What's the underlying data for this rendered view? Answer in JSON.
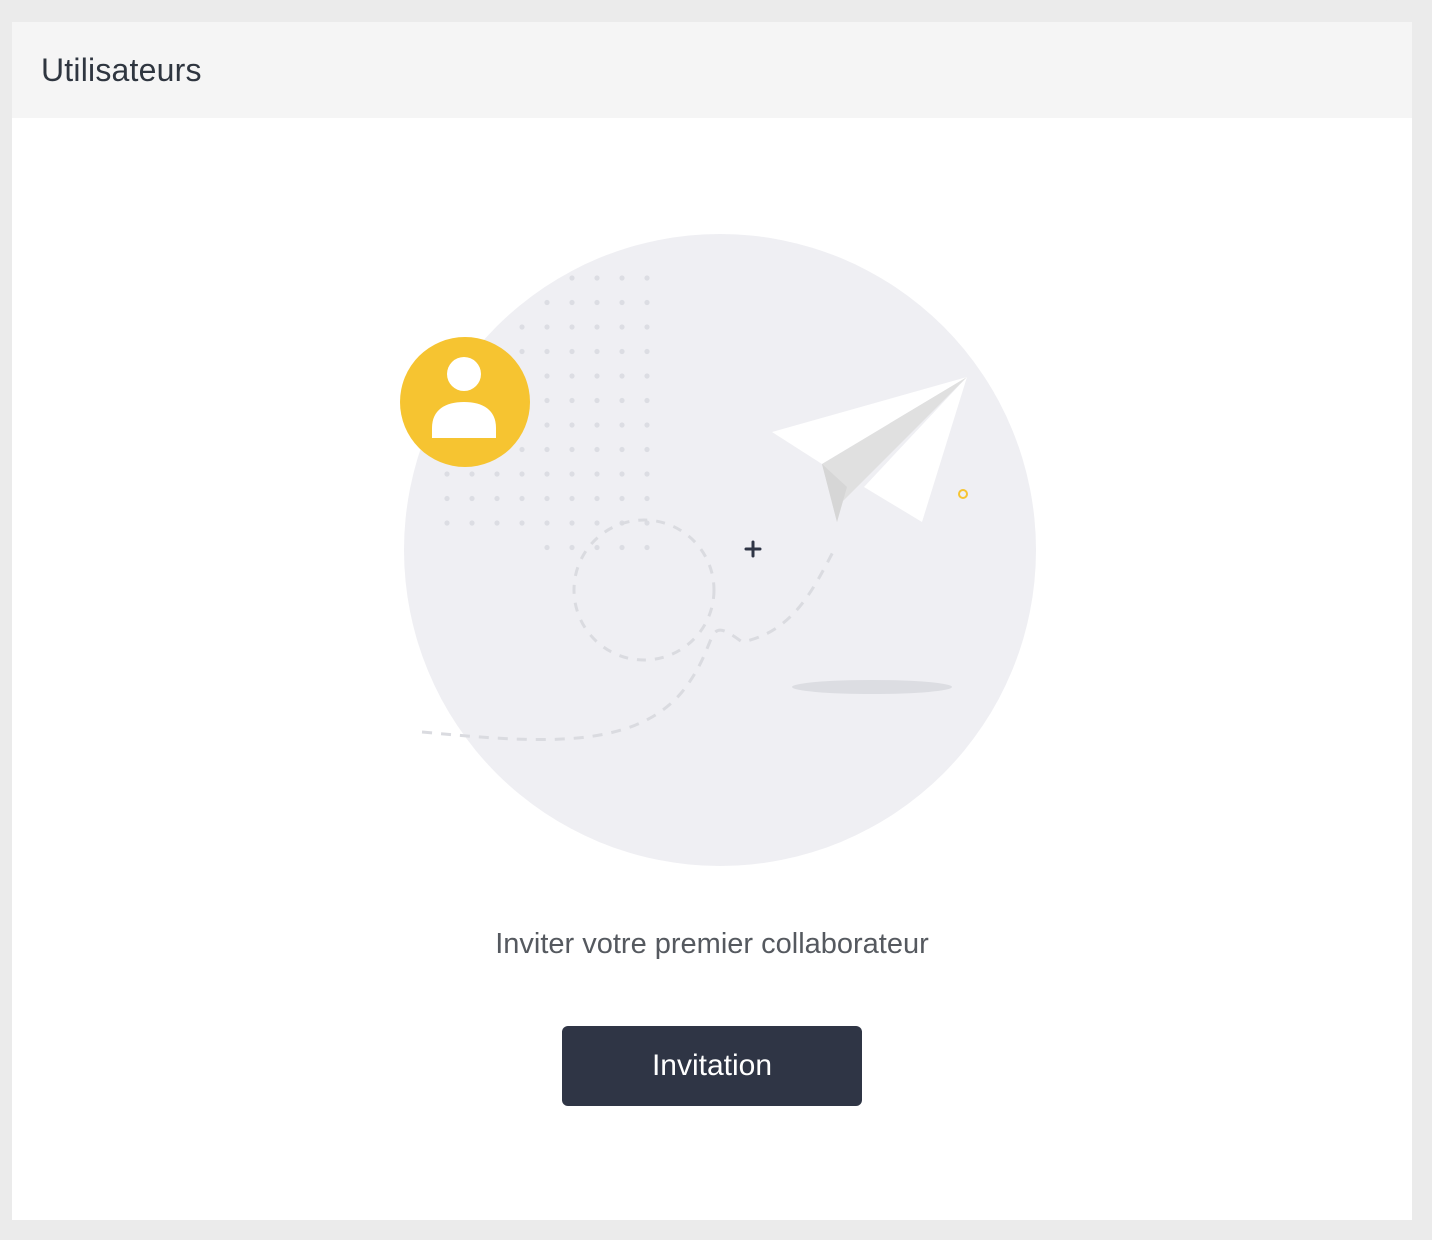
{
  "panel": {
    "title": "Utilisateurs"
  },
  "empty_state": {
    "message": "Inviter votre premier collaborateur",
    "illustration_icons": [
      "user-avatar-icon",
      "paper-plane-icon",
      "plus-icon"
    ],
    "accent_color": "#f6c431"
  },
  "actions": {
    "invite_label": "Invitation"
  }
}
